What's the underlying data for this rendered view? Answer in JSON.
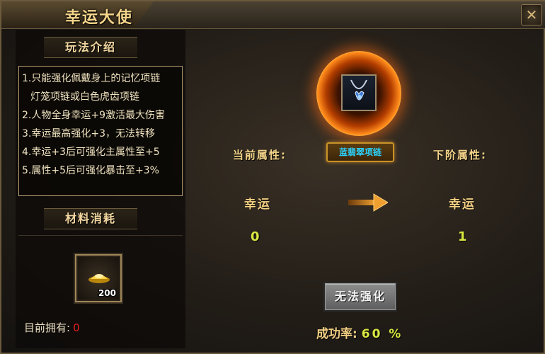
{
  "window": {
    "title": "幸运大使",
    "close_glyph": "✕"
  },
  "left": {
    "rules_header": "玩法介绍",
    "rules": [
      "1.只能强化佩戴身上的记忆项链",
      "灯笼项链或白色虎齿项链",
      "2.人物全身幸运+9激活最大伤害",
      "3.幸运最高强化+3，无法转移",
      "4.幸运+3后可强化主属性至+5",
      "5.属性+5后可强化暴击至+3%"
    ],
    "materials_header": "材料消耗",
    "material_item": {
      "icon": "gold-ingot-icon",
      "count": "200"
    },
    "owned_label": "目前拥有:",
    "owned_value": "0"
  },
  "right": {
    "equipment_icon": "necklace-icon",
    "current_label": "当前属性:",
    "next_label": "下阶属性:",
    "item_name": "蓝翡翠项链",
    "current_stat_name": "幸运",
    "current_stat_value": "0",
    "next_stat_name": "幸运",
    "next_stat_value": "1",
    "action_button": "无法强化",
    "success_label": "成功率:",
    "success_value": "60 %"
  },
  "colors": {
    "title_gold": "#f5d58a",
    "value_yellow": "#d8e840",
    "item_name_cyan": "#29d3ff",
    "owned_red": "#e81e1e"
  }
}
